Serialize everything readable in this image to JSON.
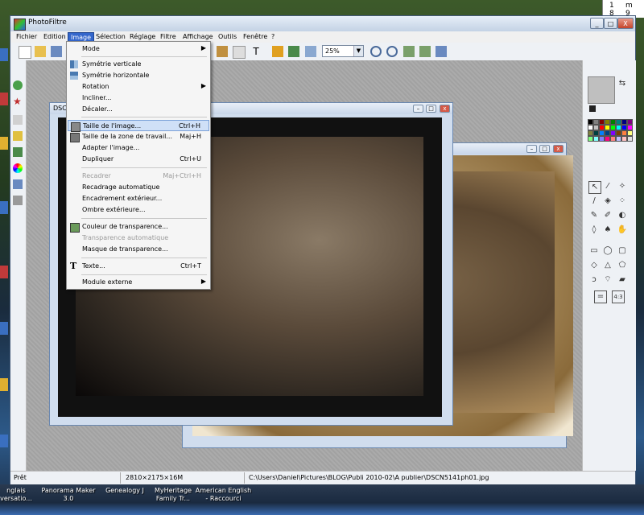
{
  "app": {
    "title": "PhotoFiltre",
    "window_buttons": [
      "_",
      "□",
      "X"
    ]
  },
  "menubar": {
    "items": [
      "Fichier",
      "Edition",
      "Image",
      "Sélection",
      "Réglage",
      "Filtre",
      "Affichage",
      "Outils",
      "Fenêtre",
      "?"
    ],
    "active": "Image"
  },
  "toolbar": {
    "zoom_value": "25%"
  },
  "image_menu": {
    "items": [
      {
        "label": "Mode",
        "submenu": true
      },
      {
        "sep": true
      },
      {
        "label": "Symétrie verticale"
      },
      {
        "label": "Symétrie horizontale"
      },
      {
        "label": "Rotation",
        "submenu": true
      },
      {
        "label": "Incliner..."
      },
      {
        "label": "Décaler..."
      },
      {
        "sep": true
      },
      {
        "label": "Taille de l'image...",
        "shortcut": "Ctrl+H",
        "highlighted": true
      },
      {
        "label": "Taille de la zone de travail...",
        "shortcut": "Maj+H"
      },
      {
        "label": "Adapter l'image..."
      },
      {
        "label": "Dupliquer",
        "shortcut": "Ctrl+U"
      },
      {
        "sep": true
      },
      {
        "label": "Recadrer",
        "shortcut": "Maj+Ctrl+H",
        "disabled": true
      },
      {
        "label": "Recadrage automatique"
      },
      {
        "label": "Encadrement extérieur..."
      },
      {
        "label": "Ombre extérieure..."
      },
      {
        "sep": true
      },
      {
        "label": "Couleur de transparence..."
      },
      {
        "label": "Transparence automatique",
        "disabled": true
      },
      {
        "label": "Masque de transparence..."
      },
      {
        "sep": true
      },
      {
        "label": "Texte...",
        "shortcut": "Ctrl+T"
      },
      {
        "sep": true
      },
      {
        "label": "Module externe",
        "submenu": true
      }
    ]
  },
  "documents": {
    "front_title": "DSC",
    "back_title": ""
  },
  "statusbar": {
    "state": "Prêt",
    "dimensions": "2810×2175×16M",
    "path": "C:\\Users\\Daniel\\Pictures\\BLOG\\Publi 2010-02\\A publier\\DSCN5141ph01.jpg"
  },
  "calendar": {
    "row1": [
      "1",
      "m"
    ],
    "row2": [
      "8",
      "9"
    ]
  },
  "desktop_shortcuts": [
    {
      "label": "nglais\nversatio..."
    },
    {
      "label": "Panorama Maker\n3.0"
    },
    {
      "label": "Genealogy J"
    },
    {
      "label": "MyHeritage\nFamily Tr..."
    },
    {
      "label": "American English\n- Raccourci"
    }
  ],
  "colors": {
    "menu_highlight": "#cfe0f7",
    "active_menu": "#3366cc",
    "workspace": "#a8a8a8"
  },
  "palette": [
    "#000000",
    "#808080",
    "#800000",
    "#808000",
    "#008000",
    "#008080",
    "#000080",
    "#800080",
    "#ffffff",
    "#c0c0c0",
    "#ff0000",
    "#ffff00",
    "#00ff00",
    "#00ffff",
    "#0000ff",
    "#ff00ff",
    "#808040",
    "#004040",
    "#0080ff",
    "#004080",
    "#8000ff",
    "#804000",
    "#ff8040",
    "#ffff80",
    "#80ff80",
    "#80ffff",
    "#8080ff",
    "#ff0080",
    "#ff8080",
    "#c0c0ff",
    "#ffc0c0",
    "#e0e0e0"
  ]
}
